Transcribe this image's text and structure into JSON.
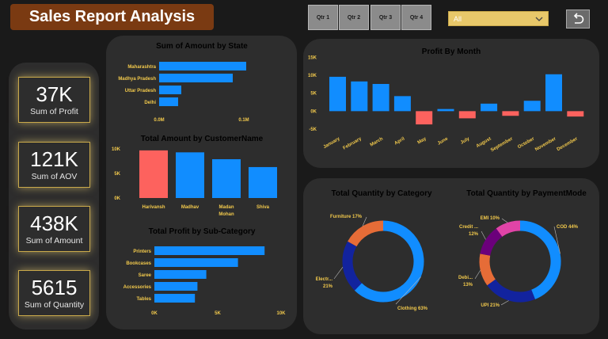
{
  "header": {
    "title": "Sales Report Analysis",
    "quarter_buttons": [
      "Qtr 1",
      "Qtr 2",
      "Qtr 3",
      "Qtr 4"
    ],
    "dropdown_value": "All",
    "back_icon": "back-arrow-icon"
  },
  "kpis": [
    {
      "value": "37K",
      "label": "Sum of Profit"
    },
    {
      "value": "121K",
      "label": "Sum of AOV"
    },
    {
      "value": "438K",
      "label": "Sum of Amount"
    },
    {
      "value": "5615",
      "label": "Sum of Quantity"
    }
  ],
  "colors": {
    "blue": "#118dff",
    "red": "#fd625e",
    "orange": "#e66c37",
    "navy": "#12239e",
    "purple": "#6b007b",
    "pink": "#e044a7",
    "label": "#f2c94c"
  },
  "chart_data": [
    {
      "type": "bar",
      "orientation": "horizontal",
      "title": "Sum of Amount by State",
      "categories": [
        "Maharashtra",
        "Madhya Pradesh",
        "Uttar Pradesh",
        "Delhi"
      ],
      "values": [
        110000,
        93000,
        28000,
        24000
      ],
      "xlim": [
        0,
        120000
      ],
      "xticks": [
        "0.0M",
        "0.1M"
      ]
    },
    {
      "type": "bar",
      "title": "Total Amount by CustomerName",
      "categories": [
        "Harivansh",
        "Madhav",
        "Madan Mohan",
        "Shiva"
      ],
      "values": [
        9700,
        9300,
        7900,
        6300
      ],
      "ylim": [
        0,
        10000
      ],
      "yticks": [
        "0K",
        "5K",
        "10K"
      ],
      "highlight_index": 0
    },
    {
      "type": "bar",
      "orientation": "horizontal",
      "title": "Total Profit by Sub-Category",
      "categories": [
        "Printers",
        "Bookcases",
        "Saree",
        "Accessories",
        "Tables"
      ],
      "values": [
        8700,
        6600,
        4100,
        3400,
        3200
      ],
      "xlim": [
        0,
        10000
      ],
      "xticks": [
        "0K",
        "5K",
        "10K"
      ]
    },
    {
      "type": "bar",
      "title": "Profit By Month",
      "categories": [
        "January",
        "February",
        "March",
        "April",
        "May",
        "June",
        "July",
        "August",
        "September",
        "October",
        "November",
        "December"
      ],
      "values": [
        9600,
        8300,
        7600,
        4200,
        -3700,
        600,
        -2000,
        2100,
        -1300,
        2900,
        10300,
        -1500
      ],
      "ylim": [
        -7000,
        16000
      ],
      "yticks": [
        "-5K",
        "0K",
        "5K",
        "10K",
        "15K"
      ]
    },
    {
      "type": "pie",
      "donut": true,
      "title": "Total Quantity by Category",
      "categories": [
        "Clothing",
        "Electronics",
        "Furniture"
      ],
      "labels": [
        "Clothing 63%",
        "Electr... 21%",
        "Furniture 17%"
      ],
      "values": [
        63,
        21,
        17
      ]
    },
    {
      "type": "pie",
      "donut": true,
      "title": "Total Quantity by PaymentMode",
      "categories": [
        "COD",
        "UPI",
        "Debit Card",
        "Credit Card",
        "EMI"
      ],
      "labels": [
        "COD 44%",
        "UPI 21%",
        "Debi... 13%",
        "Credit ... 12%",
        "EMI 10%"
      ],
      "values": [
        44,
        21,
        13,
        12,
        10
      ]
    }
  ]
}
